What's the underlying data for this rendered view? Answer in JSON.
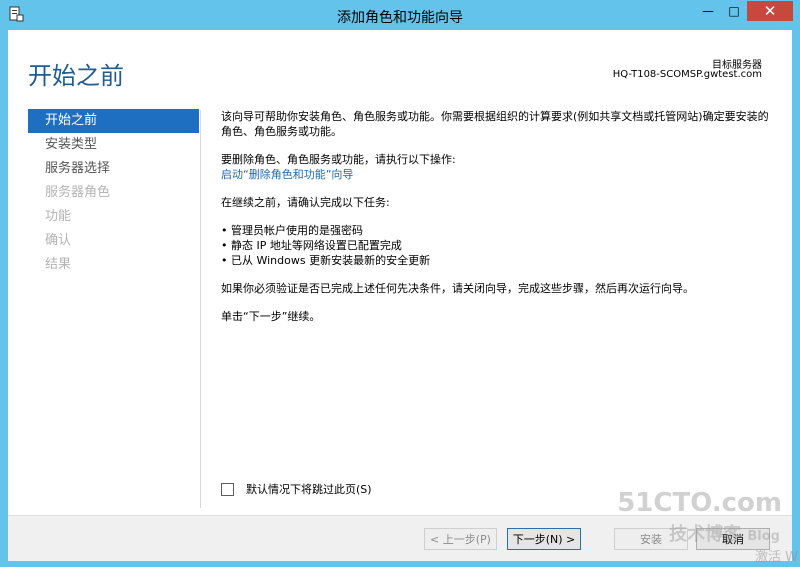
{
  "window": {
    "title": "添加角色和功能向导",
    "minimize_glyph": "—",
    "maximize_glyph": "□",
    "close_glyph": "✕"
  },
  "header": {
    "page_title": "开始之前",
    "server_label": "目标服务器",
    "server_name": "HQ-T108-SCOMSP.gwtest.com"
  },
  "nav": {
    "items": [
      {
        "label": "开始之前",
        "state": "active"
      },
      {
        "label": "安装类型",
        "state": "normal"
      },
      {
        "label": "服务器选择",
        "state": "normal"
      },
      {
        "label": "服务器角色",
        "state": "disabled"
      },
      {
        "label": "功能",
        "state": "disabled"
      },
      {
        "label": "确认",
        "state": "disabled"
      },
      {
        "label": "结果",
        "state": "disabled"
      }
    ]
  },
  "content": {
    "intro": "该向导可帮助你安装角色、角色服务或功能。你需要根据组织的计算要求(例如共享文档或托管网站)确定要安装的角色、角色服务或功能。",
    "remove_prompt": "要删除角色、角色服务或功能，请执行以下操作:",
    "remove_link": "启动“删除角色和功能”向导",
    "before_continue": "在继续之前，请确认完成以下任务:",
    "bullets": [
      "管理员帐户使用的是强密码",
      "静态 IP 地址等网络设置已配置完成",
      "已从 Windows 更新安装最新的安全更新"
    ],
    "verify_note": "如果你必须验证是否已完成上述任何先决条件，请关闭向导，完成这些步骤，然后再次运行向导。",
    "click_next": "单击“下一步”继续。"
  },
  "skip": {
    "label": "默认情况下将跳过此页(S)",
    "checked": false
  },
  "footer": {
    "prev_label": "< 上一步(P)",
    "next_label": "下一步(N) >",
    "install_label": "安装",
    "cancel_label": "取消"
  },
  "watermark": {
    "line1": "51CTO.com",
    "line2": "技术博客",
    "line2b": "Blog",
    "line3": "激活 W"
  },
  "colors": {
    "frame": "#63c3ea",
    "title_text": "#1e5c91",
    "nav_active_bg": "#1e6fc1",
    "link": "#1b6ab0",
    "close_btn": "#c7483d"
  }
}
